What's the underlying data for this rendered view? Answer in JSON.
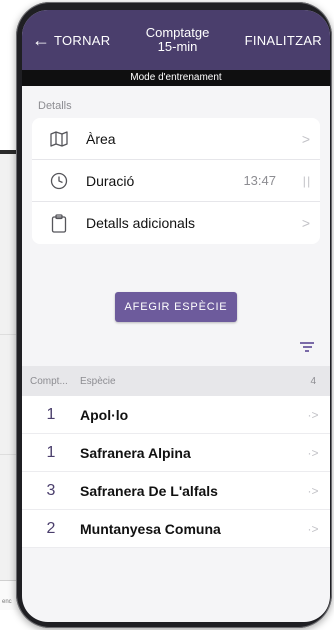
{
  "header": {
    "back_label": "TORNAR",
    "title_line1": "Comptatge",
    "title_line2": "15-min",
    "finish_label": "FINALITZAR"
  },
  "mode_banner": "Mode d'entrenament",
  "details": {
    "section_title": "Detalls",
    "items": [
      {
        "label": "Àrea",
        "icon": "map-icon"
      },
      {
        "label": "Duració",
        "value": "13:47",
        "icon": "clock-icon"
      },
      {
        "label": "Detalls adicionals",
        "icon": "clipboard-icon"
      }
    ]
  },
  "add_species_label": "AFEGIR ESPÈCIE",
  "species_list": {
    "header": {
      "count": "Compt...",
      "species": "Espècie",
      "total": "4"
    },
    "rows": [
      {
        "count": "1",
        "name": "Apol·lo"
      },
      {
        "count": "1",
        "name": "Safranera Alpina"
      },
      {
        "count": "3",
        "name": "Safranera De L'alfals"
      },
      {
        "count": "2",
        "name": "Muntanyesa Comuna"
      }
    ]
  },
  "background_app_fragment": "enc",
  "colors": {
    "appbar": "#4a3e6c",
    "accent": "#6d5b9c",
    "mode_banner": "#0f0f10"
  }
}
